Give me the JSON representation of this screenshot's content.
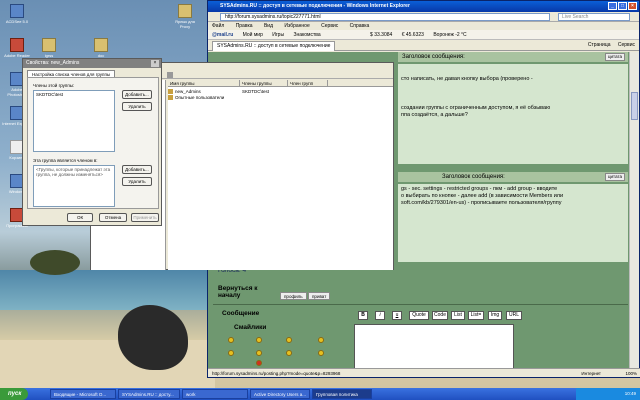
{
  "desktop": {
    "icons": [
      {
        "label": "ACDSee 5.0"
      },
      {
        "label": "Adobe Reader"
      },
      {
        "label": "Adobe Photoshop"
      },
      {
        "label": "Internet Explorer"
      },
      {
        "label": "Корзина"
      },
      {
        "label": "Windows"
      },
      {
        "label": "Программы"
      },
      {
        "label": "igrss"
      },
      {
        "label": "doc"
      },
      {
        "label": "Ярлык для Proxy"
      }
    ]
  },
  "ie": {
    "title": "SYSAdmins.RU :: доступ в сетевые подключения - Windows Internet Explorer",
    "address": "http://forum.sysadmins.ru/topic227771.html",
    "search_placeholder": "Live Search",
    "menu": [
      "Файл",
      "Правка",
      "Вид",
      "Избранное",
      "Сервис",
      "Справка"
    ],
    "mailbar": [
      "@mail.ru",
      "Мой мир",
      "Игры",
      "Знакомства",
      "$ 33.3084",
      "€ 45.6323",
      "Воронеж -2 °C"
    ],
    "tab_label": "SYSAdmins.RU :: доступ в сетевые подключение",
    "tab_tools": [
      "Страница",
      "Сервис"
    ],
    "status_url": "http://forum.sysadmins.ru/posting.php?mode=quote&p=8293968",
    "status_zone": "Интернет",
    "status_zoom": "100%",
    "post1_header": "Заголовок сообщения:",
    "post1_lines": [
      "сто написать, не давая кнопку выбора (проверено -",
      "создании группы с ограниченным доступом, я её обзываю",
      "ппа создаётся, а дальше?"
    ],
    "quote_label": "цитата",
    "post2_header": "Заголовок сообщения:",
    "post2_lines": [
      "gs - sec. settings - restricted groups - пкм - add group - вводите",
      "о выбирать по кнопке - далее add (в зависимости Members или",
      "soft.com/kb/279301/en-us) - прописываете пользователя/группу"
    ],
    "votes": "Голоса: 4",
    "back_label": "Вернуться к началу",
    "profile_button": "профиль",
    "pm_button": "приват",
    "message_label": "Сообщение",
    "smileys_label": "Смайлики",
    "editor_buttons": [
      "B",
      "i",
      "u",
      "Quote",
      "Code",
      "List",
      "List=",
      "Img",
      "URL"
    ]
  },
  "props": {
    "title": "Свойства: new_Admins",
    "tab": "Настройка списка членов для группы",
    "members_label": "Члены этой группы:",
    "members": [
      "SKDTDC\\test"
    ],
    "add_button": "Добавить...",
    "remove_button": "Удалить",
    "memberof_label": "Эта группа является членом в:",
    "memberof_hint": "<Группы, которые принадлежат эта группа, не должны изменяться>",
    "add2_button": "Добавить...",
    "remove2_button": "Удалить",
    "ok_button": "ОК",
    "cancel_button": "Отмена",
    "apply_button": "Применить"
  },
  "mmc": {
    "columns": [
      "Имя группы",
      "Члены группы",
      "Член групп"
    ],
    "rows": [
      {
        "name": "new_Admins",
        "members": "SKDTDC\\test"
      },
      {
        "name": "Опытные пользователи",
        "members": ""
      }
    ]
  },
  "taskbar": {
    "start": "пуск",
    "buttons": [
      "Входящие - Microsoft O...",
      "SYSAdmins.RU :: досту...",
      "work",
      "Active Directory Users a...",
      "Групповая политика"
    ],
    "tray_time": "10:49"
  }
}
